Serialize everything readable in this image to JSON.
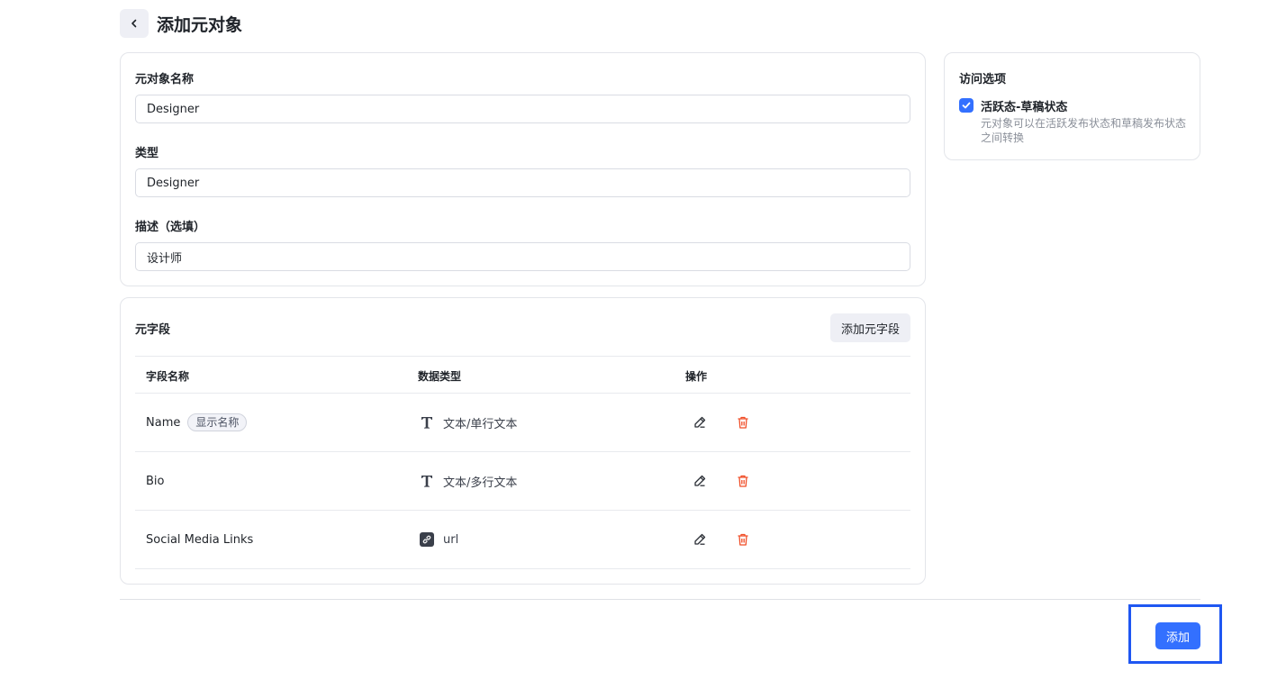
{
  "header": {
    "back_icon": "chevron-left-icon",
    "title": "添加元对象"
  },
  "basic": {
    "name_label": "元对象名称",
    "name_value": "Designer",
    "type_label": "类型",
    "type_value": "Designer",
    "desc_label": "描述（选填）",
    "desc_value": "设计师"
  },
  "access": {
    "title": "访问选项",
    "option_checked": true,
    "option_label": "活跃态-草稿状态",
    "option_desc": "元对象可以在活跃发布状态和草稿发布状态之间转换"
  },
  "fields": {
    "title": "元字段",
    "add_button": "添加元字段",
    "columns": [
      "字段名称",
      "数据类型",
      "操作"
    ],
    "rows": [
      {
        "name": "Name",
        "badge": "显示名称",
        "type_icon": "text-type-icon",
        "type": "文本/单行文本"
      },
      {
        "name": "Bio",
        "type_icon": "text-type-icon",
        "type": "文本/多行文本"
      },
      {
        "name": "Social Media Links",
        "type_icon": "link-icon",
        "type": "url"
      }
    ]
  },
  "footer": {
    "submit_label": "添加"
  },
  "colors": {
    "primary": "#3370ff",
    "danger": "#f04d27",
    "highlight": "#1f57f2"
  }
}
